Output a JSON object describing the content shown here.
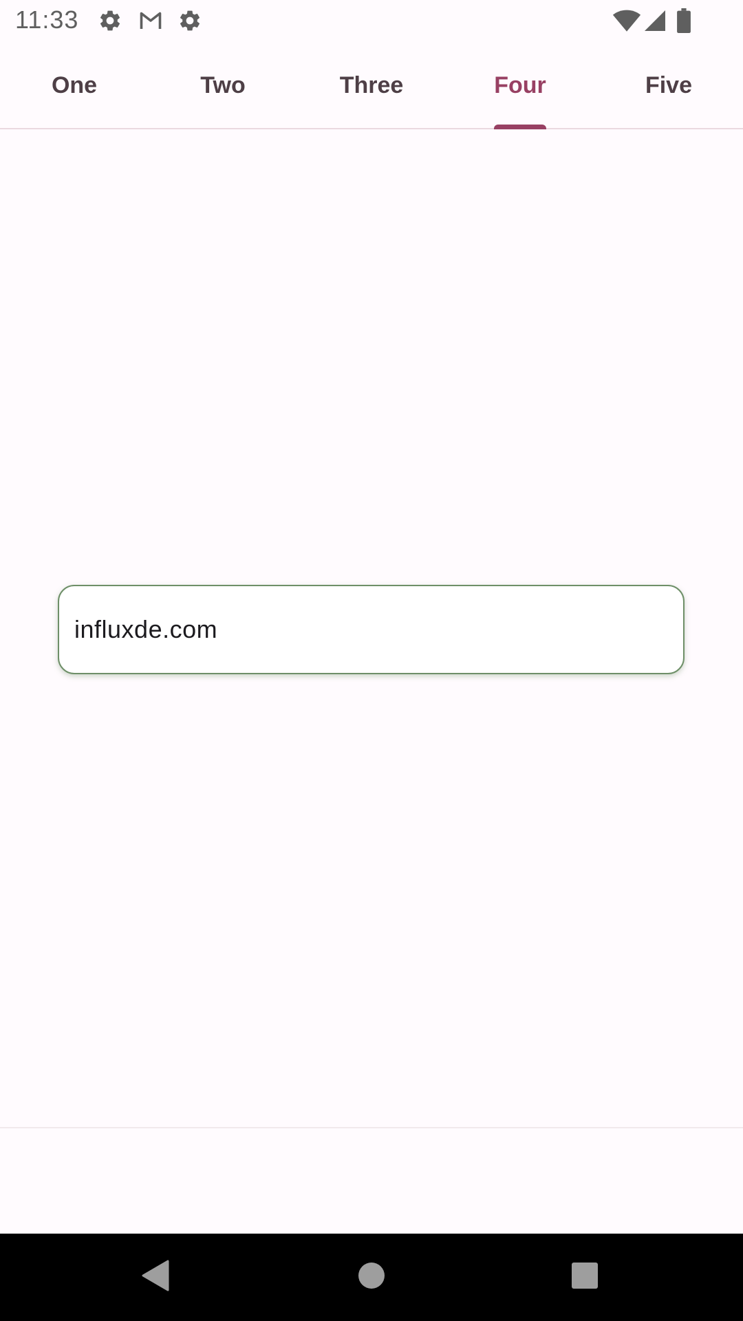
{
  "status_bar": {
    "time": "11:33",
    "icons": [
      "settings-gear-icon",
      "gmail-icon",
      "settings-outline-icon",
      "wifi-icon",
      "cellular-signal-icon",
      "battery-icon"
    ],
    "icon_color": "#5F5F5F"
  },
  "tabs": [
    {
      "label": "One",
      "active": false
    },
    {
      "label": "Two",
      "active": false
    },
    {
      "label": "Three",
      "active": false
    },
    {
      "label": "Four",
      "active": true
    },
    {
      "label": "Five",
      "active": false
    }
  ],
  "text_field": {
    "value": "influxde.com"
  },
  "navigation_bar": {
    "buttons": [
      "back-icon",
      "home-icon",
      "recents-icon"
    ]
  },
  "colors": {
    "background": "#FFFBFE",
    "accent": "#984063",
    "tab_text": "#4E3F46",
    "field_border": "#6E8F68",
    "nav_background": "#000000"
  }
}
